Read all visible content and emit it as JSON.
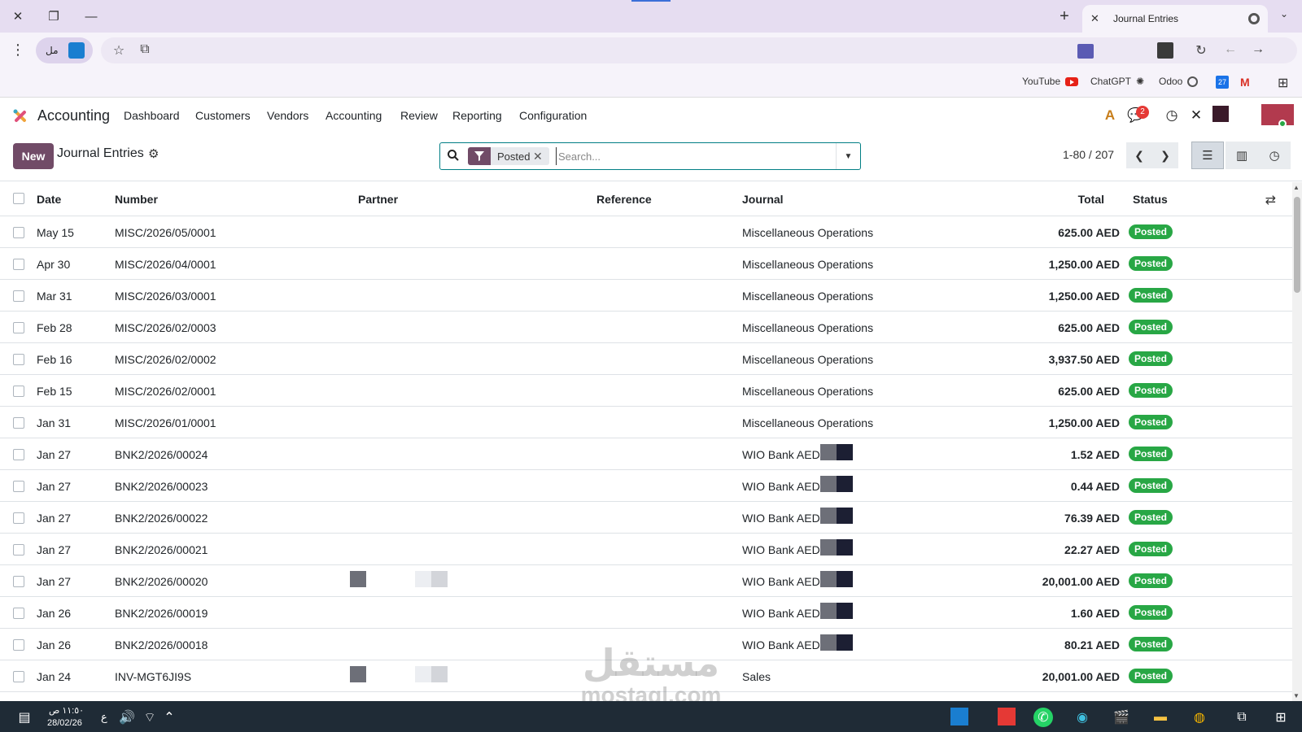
{
  "browser": {
    "tab_title": "Journal Entries",
    "profile_label": "مل",
    "bookmarks": [
      {
        "label": "YouTube",
        "icon": "youtube-icon"
      },
      {
        "label": "ChatGPT",
        "icon": "chatgpt-icon"
      },
      {
        "label": "Odoo",
        "icon": "odoo-icon"
      }
    ],
    "calendar_day": "27"
  },
  "navbar": {
    "app_name": "Accounting",
    "menu": [
      "Dashboard",
      "Customers",
      "Vendors",
      "Accounting",
      "Review",
      "Reporting",
      "Configuration"
    ],
    "chat_count": "2"
  },
  "control_panel": {
    "new_label": "New",
    "title": "Journal Entries",
    "facet_value": "Posted",
    "search_placeholder": "Search...",
    "pager_value": "1-80 / 207"
  },
  "list": {
    "columns": {
      "date": "Date",
      "number": "Number",
      "partner": "Partner",
      "reference": "Reference",
      "journal": "Journal",
      "total": "Total",
      "status": "Status"
    },
    "rows": [
      {
        "date": "May 15",
        "number": "MISC/2026/05/0001",
        "journal": "Miscellaneous Operations",
        "total": "625.00 AED",
        "status": "Posted"
      },
      {
        "date": "Apr 30",
        "number": "MISC/2026/04/0001",
        "journal": "Miscellaneous Operations",
        "total": "1,250.00 AED",
        "status": "Posted"
      },
      {
        "date": "Mar 31",
        "number": "MISC/2026/03/0001",
        "journal": "Miscellaneous Operations",
        "total": "1,250.00 AED",
        "status": "Posted"
      },
      {
        "date": "Feb 28",
        "number": "MISC/2026/02/0003",
        "journal": "Miscellaneous Operations",
        "total": "625.00 AED",
        "status": "Posted"
      },
      {
        "date": "Feb 16",
        "number": "MISC/2026/02/0002",
        "journal": "Miscellaneous Operations",
        "total": "3,937.50 AED",
        "status": "Posted"
      },
      {
        "date": "Feb 15",
        "number": "MISC/2026/02/0001",
        "journal": "Miscellaneous Operations",
        "total": "625.00 AED",
        "status": "Posted"
      },
      {
        "date": "Jan 31",
        "number": "MISC/2026/01/0001",
        "journal": "Miscellaneous Operations",
        "total": "1,250.00 AED",
        "status": "Posted"
      },
      {
        "date": "Jan 27",
        "number": "BNK2/2026/00024",
        "journal": "WIO Bank AED #",
        "total": "1.52 AED",
        "status": "Posted"
      },
      {
        "date": "Jan 27",
        "number": "BNK2/2026/00023",
        "journal": "WIO Bank AED #",
        "total": "0.44 AED",
        "status": "Posted"
      },
      {
        "date": "Jan 27",
        "number": "BNK2/2026/00022",
        "journal": "WIO Bank AED #",
        "total": "76.39 AED",
        "status": "Posted"
      },
      {
        "date": "Jan 27",
        "number": "BNK2/2026/00021",
        "journal": "WIO Bank AED #",
        "total": "22.27 AED",
        "status": "Posted"
      },
      {
        "date": "Jan 27",
        "number": "BNK2/2026/00020",
        "journal": "WIO Bank AED #",
        "total": "20,001.00 AED",
        "status": "Posted"
      },
      {
        "date": "Jan 26",
        "number": "BNK2/2026/00019",
        "journal": "WIO Bank AED #",
        "total": "1.60 AED",
        "status": "Posted"
      },
      {
        "date": "Jan 26",
        "number": "BNK2/2026/00018",
        "journal": "WIO Bank AED #",
        "total": "80.21 AED",
        "status": "Posted"
      },
      {
        "date": "Jan 24",
        "number": "INV-MGT6JI9S",
        "journal": "Sales",
        "total": "20,001.00 AED",
        "status": "Posted"
      }
    ]
  },
  "watermark": {
    "arabic": "مستقل",
    "latin": "mostaql.com"
  },
  "taskbar": {
    "time": "١١:٥٠ ص",
    "date": "28/02/26",
    "lang": "ع"
  },
  "colors": {
    "brand": "#714b67",
    "posted_badge": "#28a745",
    "search_border": "#017e84",
    "titlebar": "#e6ddf1"
  }
}
